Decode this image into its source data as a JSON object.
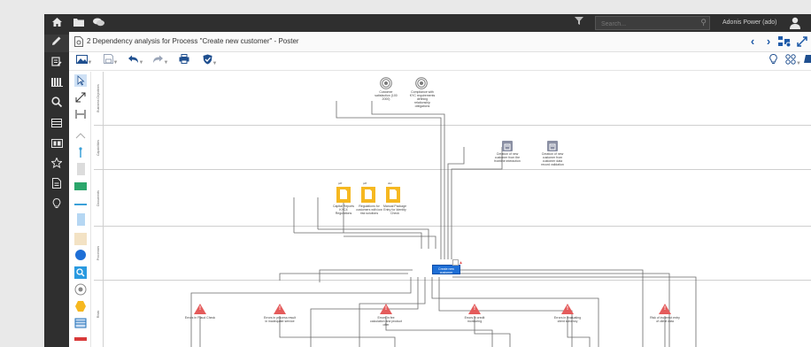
{
  "top_bar": {
    "icons": [
      "home-icon",
      "folder-icon",
      "chat-icon"
    ],
    "filter_icon": "filter-icon",
    "search": {
      "placeholder": "Search...",
      "value": ""
    },
    "user_label": "Adonis Power (ado)",
    "user_icon": "user-icon"
  },
  "left_nav": {
    "items": [
      "pencil-icon",
      "edit-list-icon",
      "library-icon",
      "search-icon",
      "table-icon",
      "dashboard-icon",
      "star-icon",
      "document-icon",
      "lightbulb-icon"
    ],
    "active_index": 0
  },
  "title_bar": {
    "title": "2 Dependency analysis for Process \"Create new customer\" - Poster",
    "right_icons": [
      "chevron-left-icon",
      "chevron-right-icon",
      "network-icon",
      "expand-icon"
    ]
  },
  "toolbar": {
    "left": [
      "image-icon",
      "save-icon",
      "undo-icon",
      "redo-icon",
      "print-icon",
      "shield-check-icon"
    ],
    "right": [
      "lightbulb-icon",
      "grid-icon",
      "book-icon"
    ]
  },
  "palette": {
    "items": [
      "pointer-icon",
      "connector-icon",
      "spacer-icon",
      "arrow-up-icon",
      "vertical-line-icon",
      "grey-block-icon",
      "green-block-icon",
      "horizontal-line-icon",
      "blue-block-icon",
      "beige-block-icon",
      "circle-icon",
      "magnifier-icon",
      "eye-icon",
      "hexagon-icon",
      "table-icon",
      "red-bar-icon"
    ]
  },
  "diagram": {
    "lanes": [
      {
        "label": "Business Objectives"
      },
      {
        "label": "Capabilities"
      },
      {
        "label": "Documents"
      },
      {
        "label": "Processes"
      },
      {
        "label": "Risks"
      }
    ],
    "objectives": [
      {
        "label": "Customer satisfaction (100 2000)"
      },
      {
        "label": "Compliance with KYC requirements defining relationship obligations"
      }
    ],
    "capabilities": [
      {
        "label": "Creation of new customer from the frontline interaction"
      },
      {
        "label": "Creation of new customer from customer data record validation"
      }
    ],
    "documents": [
      {
        "badge": "pdf",
        "label": "Capital Reports KYC4 Regulations"
      },
      {
        "badge": "pdf",
        "label": "Regulations for customers with low risk solutions"
      },
      {
        "badge": "doc",
        "label": "Manual Package Entry for Identity Check"
      }
    ],
    "process": {
      "label": "Create new customer"
    },
    "risks": [
      {
        "label": "Errors in Fraud Check"
      },
      {
        "label": "Errors in process result in inadequate service"
      },
      {
        "label": "Errors in fee calculation and product offer"
      },
      {
        "label": "Errors in credit monitoring"
      },
      {
        "label": "Errors in evaluating client solvency"
      },
      {
        "label": "Risk of incorrect entry of client data"
      }
    ]
  },
  "colors": {
    "nav_bg": "#2f2f2f",
    "accent": "#1e5aa8",
    "process_blue": "#1e6fd6",
    "risk_red": "#e45b5b",
    "document_orange": "#f6b820",
    "capability_grey": "#8a8fa3"
  }
}
